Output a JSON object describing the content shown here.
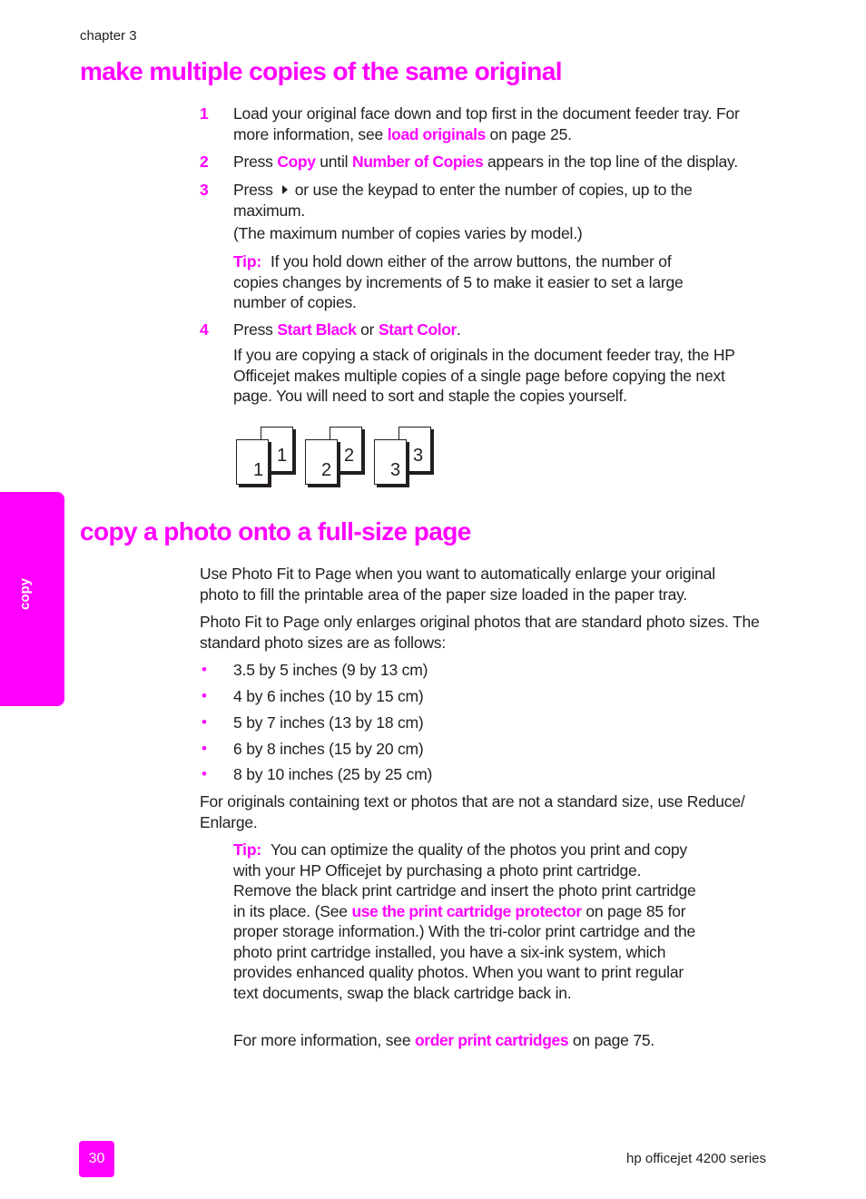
{
  "header": {
    "chapter": "chapter 3"
  },
  "section1": {
    "title": "make multiple copies of the same original",
    "steps": [
      {
        "num": "1",
        "text_a": "Load your original face down and top first in the document feeder tray. For more information, see ",
        "link": "load originals",
        "text_b": " on page 25."
      },
      {
        "num": "2",
        "text_a": "Press ",
        "link1": "Copy",
        "text_b": " until ",
        "link2": "Number of Copies",
        "text_c": " appears in the top line of the display."
      },
      {
        "num": "3",
        "text_a": "Press",
        "icon": "right-arrow-icon",
        "text_b": "or use the keypad to enter the number of copies, up to the maximum.",
        "note": "(The maximum number of copies varies by model.)",
        "tip_label": "Tip:",
        "tip_text": "If you hold down either of the arrow buttons, the number of copies changes by increments of 5 to make it easier to set a large number of copies."
      },
      {
        "num": "4",
        "text_a": "Press ",
        "link1": "Start Black",
        "text_b": " or ",
        "link2": "Start Color",
        "text_c": ".",
        "para": "If you are copying a stack of originals in the document feeder tray, the HP Officejet makes multiple copies of a single page before copying the next page. You will need to sort and staple the copies yourself."
      }
    ],
    "illustration": {
      "pairs": [
        {
          "back": "1",
          "front": "1"
        },
        {
          "back": "2",
          "front": "2"
        },
        {
          "back": "3",
          "front": "3"
        }
      ]
    }
  },
  "side_tab": {
    "label": "copy",
    "color": "#ff00ff"
  },
  "section2": {
    "title": "copy a photo onto a full-size page",
    "para1": "Use Photo Fit to Page when you want to automatically enlarge your original photo to fill the printable area of the paper size loaded in the paper tray.",
    "para2": "Photo Fit to Page only enlarges original photos that are standard photo sizes. The standard photo sizes are as follows:",
    "sizes": [
      "3.5 by 5 inches (9 by 13 cm)",
      "4 by 6 inches (10 by 15 cm)",
      "5 by 7 inches (13 by 18 cm)",
      "6 by 8 inches (15 by 20 cm)",
      "8 by 10 inches (25 by 25 cm)"
    ],
    "para3": "For originals containing text or photos that are not a standard size, use Reduce/ Enlarge.",
    "tip_label": "Tip:",
    "tip_text_a": "You can optimize the quality of the photos you print and copy with your HP Officejet by purchasing a photo print cartridge. Remove the black print cartridge and insert the photo print cartridge in its place. (See ",
    "tip_link": "use the print cartridge protector",
    "tip_text_b": " on page 85 for proper storage information.) With the tri-color print cartridge and the photo print cartridge installed, you have a six-ink system, which provides enhanced quality photos. When you want to print regular text documents, swap the black cartridge back in.",
    "more_a": "For more information, see ",
    "more_link": "order print cartridges",
    "more_b": " on page 75."
  },
  "footer": {
    "page_number": "30",
    "product": "hp officejet 4200 series"
  }
}
